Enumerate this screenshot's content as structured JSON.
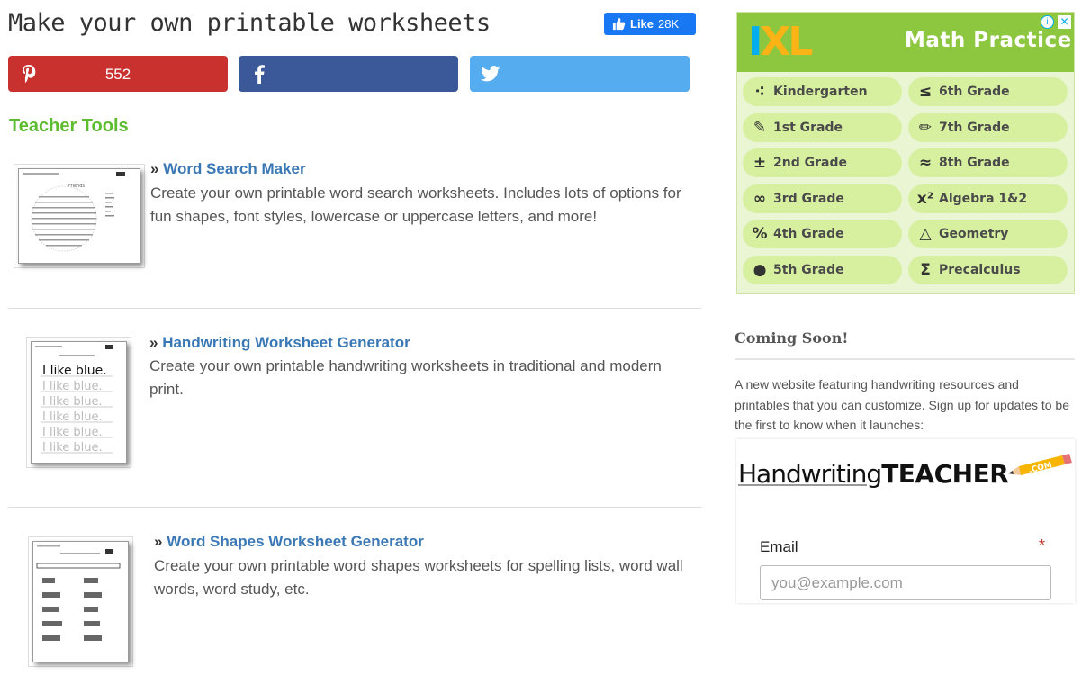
{
  "page": {
    "title": "Make your own printable worksheets"
  },
  "social": {
    "fb_like_label": "Like",
    "fb_like_count": "28K",
    "pinterest_count": "552",
    "colors": {
      "pinterest": "#c8312e",
      "facebook": "#3b5998",
      "twitter": "#55acee"
    }
  },
  "section": {
    "heading": "Teacher Tools"
  },
  "tools": [
    {
      "prefix": "»",
      "title": "Word Search Maker",
      "description": "Create your own printable word search worksheets. Includes lots of options for fun shapes, font styles, lowercase or uppercase letters, and more!"
    },
    {
      "prefix": "»",
      "title": "Handwriting Worksheet Generator",
      "description": "Create your own printable handwriting worksheets in traditional and modern print."
    },
    {
      "prefix": "»",
      "title": "Word Shapes Worksheet Generator",
      "description": "Create your own printable word shapes worksheets for spelling lists, word wall words, word study, etc."
    }
  ],
  "thumb_text": {
    "wordsearch_title": "Friends",
    "handwriting_line": "I like blue."
  },
  "ad": {
    "brand": [
      "I",
      "X",
      "L"
    ],
    "title": "Math Practice",
    "info": "i",
    "close": "✕",
    "grades_left": [
      {
        "icon": "dots-icon",
        "glyph": "⁖",
        "label": "Kindergarten"
      },
      {
        "icon": "pencil-cup-icon",
        "glyph": "✎",
        "label": "1st Grade"
      },
      {
        "icon": "plus-minus-icon",
        "glyph": "±",
        "label": "2nd Grade"
      },
      {
        "icon": "infinity-icon",
        "glyph": "∞",
        "label": "3rd Grade"
      },
      {
        "icon": "percent-icon",
        "glyph": "%",
        "label": "4th Grade"
      },
      {
        "icon": "apple-icon",
        "glyph": "●",
        "label": "5th Grade"
      }
    ],
    "grades_right": [
      {
        "icon": "less-equal-icon",
        "glyph": "≤",
        "label": "6th Grade"
      },
      {
        "icon": "ruler-pencil-icon",
        "glyph": "✏",
        "label": "7th Grade"
      },
      {
        "icon": "approx-icon",
        "glyph": "≈",
        "label": "8th Grade"
      },
      {
        "icon": "x-squared-icon",
        "glyph": "x²",
        "label": "Algebra 1&2"
      },
      {
        "icon": "triangle-icon",
        "glyph": "△",
        "label": "Geometry"
      },
      {
        "icon": "sigma-icon",
        "glyph": "Σ",
        "label": "Precalculus"
      }
    ]
  },
  "sidebar": {
    "heading": "Coming Soon!",
    "text": "A new website featuring handwriting resources and printables that you can customize.  Sign up for updates to be the first to know when it launches:",
    "logo_handwriting": "Handwriting",
    "logo_teacher": "TEACHER",
    "logo_com": ".COM",
    "email_label": "Email",
    "email_required": "*",
    "email_placeholder": "you@example.com"
  }
}
